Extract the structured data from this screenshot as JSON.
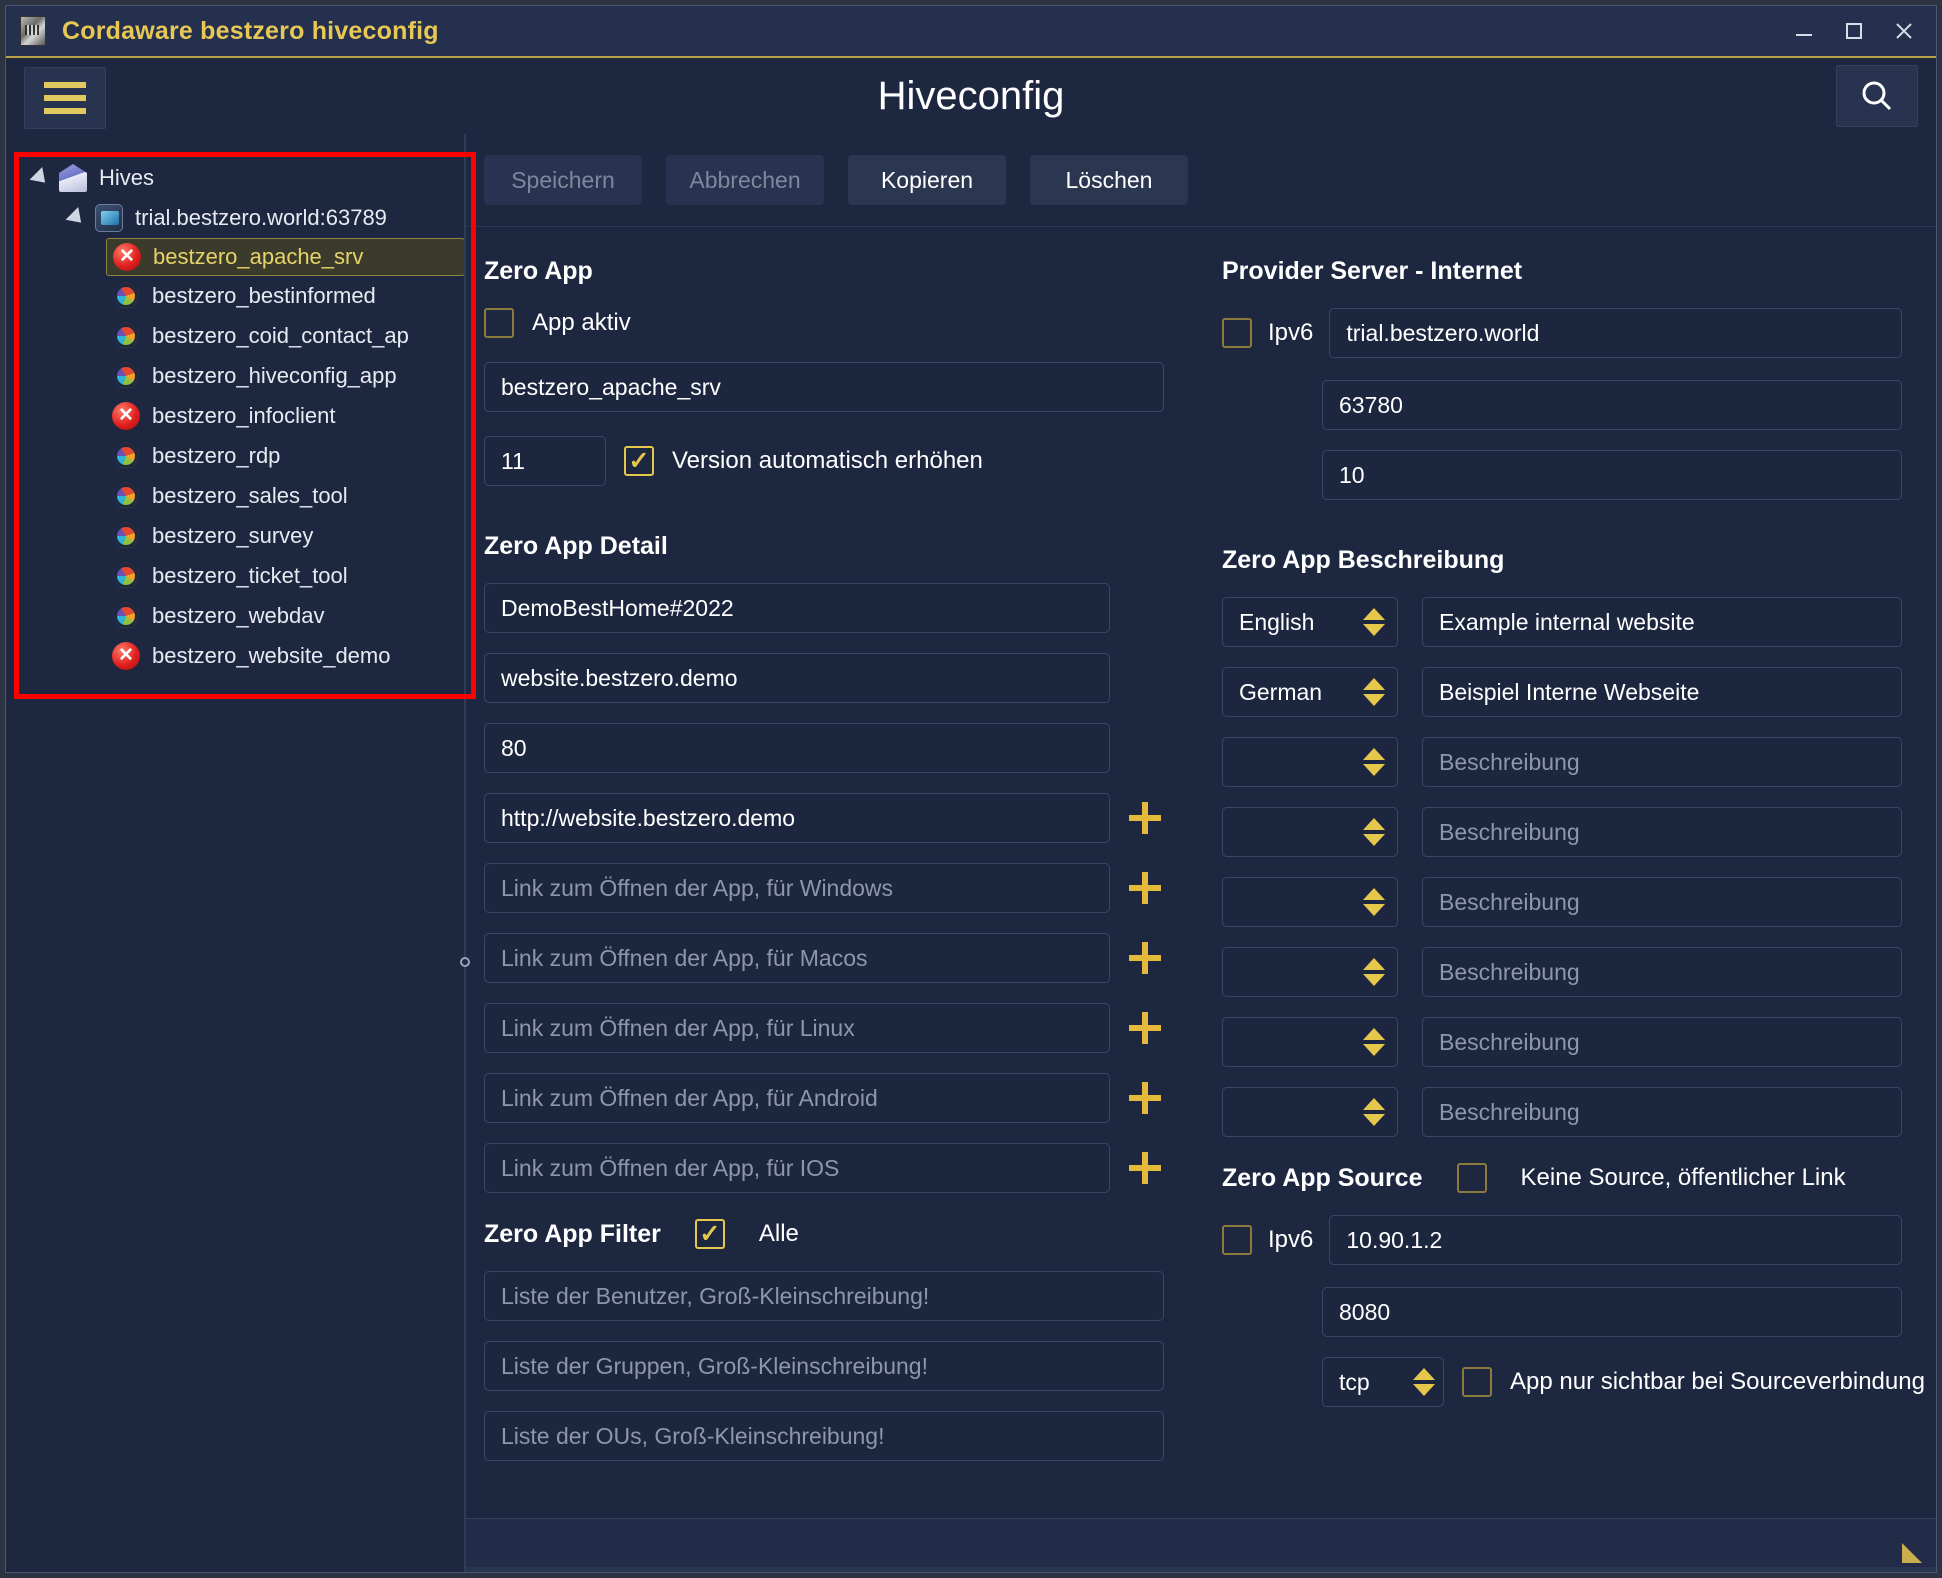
{
  "window": {
    "title": "Cordaware bestzero hiveconfig",
    "icon": "app-icon",
    "controls": {
      "minimize": "minimize-icon",
      "maximize": "maximize-icon",
      "close": "close-icon"
    }
  },
  "header": {
    "menu_icon": "hamburger-icon",
    "title": "Hiveconfig",
    "search_icon": "search-icon"
  },
  "sidebar": {
    "tree": [
      {
        "label": "Hives",
        "level": 1,
        "icon": "hive-icon",
        "expander": true,
        "state": "normal"
      },
      {
        "label": "trial.bestzero.world:63789",
        "level": 2,
        "icon": "server-icon",
        "expander": true,
        "state": "normal"
      },
      {
        "label": "bestzero_apache_srv",
        "level": 3,
        "icon": "error-icon",
        "expander": false,
        "state": "selected"
      },
      {
        "label": "bestzero_bestinformed",
        "level": 3,
        "icon": "app-icon",
        "expander": false,
        "state": "normal"
      },
      {
        "label": "bestzero_coid_contact_ap",
        "level": 3,
        "icon": "app-icon",
        "expander": false,
        "state": "normal"
      },
      {
        "label": "bestzero_hiveconfig_app",
        "level": 3,
        "icon": "app-icon",
        "expander": false,
        "state": "normal"
      },
      {
        "label": "bestzero_infoclient",
        "level": 3,
        "icon": "error-icon",
        "expander": false,
        "state": "normal"
      },
      {
        "label": "bestzero_rdp",
        "level": 3,
        "icon": "app-icon",
        "expander": false,
        "state": "normal"
      },
      {
        "label": "bestzero_sales_tool",
        "level": 3,
        "icon": "app-icon",
        "expander": false,
        "state": "normal"
      },
      {
        "label": "bestzero_survey",
        "level": 3,
        "icon": "app-icon",
        "expander": false,
        "state": "normal"
      },
      {
        "label": "bestzero_ticket_tool",
        "level": 3,
        "icon": "app-icon",
        "expander": false,
        "state": "normal"
      },
      {
        "label": "bestzero_webdav",
        "level": 3,
        "icon": "app-icon",
        "expander": false,
        "state": "normal"
      },
      {
        "label": "bestzero_website_demo",
        "level": 3,
        "icon": "error-icon",
        "expander": false,
        "state": "normal"
      }
    ],
    "highlight_color": "#ff0000"
  },
  "toolbar": {
    "save_label": "Speichern",
    "cancel_label": "Abbrechen",
    "copy_label": "Kopieren",
    "delete_label": "Löschen"
  },
  "zero_app": {
    "title": "Zero App",
    "active_checkbox_label": "App aktiv",
    "active_checked": false,
    "name_value": "bestzero_apache_srv",
    "version_value": "11",
    "auto_version_label": "Version automatisch erhöhen",
    "auto_version_checked": true
  },
  "provider_server": {
    "title": "Provider Server - Internet",
    "ipv6_label": "Ipv6",
    "ipv6_checked": false,
    "host_value": "trial.bestzero.world",
    "port_value": "63780",
    "timeout_value": "10"
  },
  "zero_app_detail": {
    "title": "Zero App Detail",
    "fields": [
      {
        "value": "DemoBestHome#2022",
        "placeholder": "",
        "has_plus": false
      },
      {
        "value": "website.bestzero.demo",
        "placeholder": "",
        "has_plus": false
      },
      {
        "value": "80",
        "placeholder": "",
        "has_plus": false
      },
      {
        "value": "http://website.bestzero.demo",
        "placeholder": "",
        "has_plus": true
      },
      {
        "value": "",
        "placeholder": "Link zum Öffnen der App, für Windows",
        "has_plus": true
      },
      {
        "value": "",
        "placeholder": "Link zum Öffnen der App, für Macos",
        "has_plus": true
      },
      {
        "value": "",
        "placeholder": "Link zum Öffnen der App, für Linux",
        "has_plus": true
      },
      {
        "value": "",
        "placeholder": "Link zum Öffnen der App, für Android",
        "has_plus": true
      },
      {
        "value": "",
        "placeholder": "Link zum Öffnen der App, für IOS",
        "has_plus": true
      }
    ]
  },
  "zero_app_beschreibung": {
    "title": "Zero App Beschreibung",
    "rows": [
      {
        "language": "English",
        "description": "Example internal website",
        "placeholder": "Beschreibung"
      },
      {
        "language": "German",
        "description": "Beispiel Interne Webseite",
        "placeholder": "Beschreibung"
      },
      {
        "language": "",
        "description": "",
        "placeholder": "Beschreibung"
      },
      {
        "language": "",
        "description": "",
        "placeholder": "Beschreibung"
      },
      {
        "language": "",
        "description": "",
        "placeholder": "Beschreibung"
      },
      {
        "language": "",
        "description": "",
        "placeholder": "Beschreibung"
      },
      {
        "language": "",
        "description": "",
        "placeholder": "Beschreibung"
      },
      {
        "language": "",
        "description": "",
        "placeholder": "Beschreibung"
      }
    ]
  },
  "zero_app_filter": {
    "title": "Zero App Filter",
    "all_label": "Alle",
    "all_checked": true,
    "users_placeholder": "Liste der Benutzer, Groß-Kleinschreibung!",
    "groups_placeholder": "Liste der Gruppen, Groß-Kleinschreibung!",
    "ous_placeholder": "Liste der OUs, Groß-Kleinschreibung!",
    "users_value": "",
    "groups_value": "",
    "ous_value": ""
  },
  "zero_app_source": {
    "title": "Zero App Source",
    "no_source_label": "Keine Source, öffentlicher Link",
    "no_source_checked": false,
    "ipv6_label": "Ipv6",
    "ipv6_checked": false,
    "host_value": "10.90.1.2",
    "port_value": "8080",
    "protocol_value": "tcp",
    "visible_only_label": "App nur sichtbar bei Sourceverbindung",
    "visible_only_checked": false
  },
  "statusbar": {
    "resize_grip": "resize-grip-icon"
  }
}
